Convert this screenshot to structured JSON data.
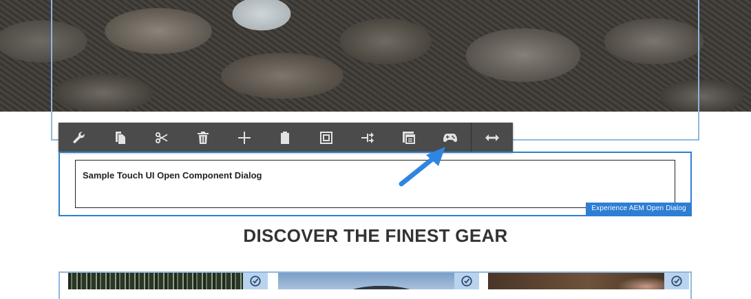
{
  "toolbar": {
    "items": [
      {
        "name": "configure",
        "icon": "wrench-icon"
      },
      {
        "name": "copy",
        "icon": "copy-icon"
      },
      {
        "name": "cut",
        "icon": "scissors-icon"
      },
      {
        "name": "delete",
        "icon": "trash-icon"
      },
      {
        "name": "insert",
        "icon": "plus-icon"
      },
      {
        "name": "paste",
        "icon": "clipboard-icon"
      },
      {
        "name": "group",
        "icon": "group-icon"
      },
      {
        "name": "convert",
        "icon": "convert-icon"
      },
      {
        "name": "layout",
        "icon": "layout-icon"
      },
      {
        "name": "open-dialog",
        "icon": "gamepad-icon"
      },
      {
        "name": "resize",
        "icon": "resize-horizontal-icon"
      }
    ]
  },
  "component": {
    "title": "Sample Touch UI Open Component Dialog",
    "badge": "Experience AEM Open Dialog"
  },
  "section": {
    "heading": "DISCOVER THE FINEST GEAR"
  },
  "cards": [
    {
      "icon": "edit-check-icon"
    },
    {
      "icon": "edit-check-icon"
    },
    {
      "icon": "edit-check-icon"
    }
  ],
  "colors": {
    "toolbar_bg": "#4b4b4b",
    "accent_blue": "#2e7ed3",
    "frame_light_blue": "#8fb7df",
    "arrow_blue": "#2f86e0"
  }
}
